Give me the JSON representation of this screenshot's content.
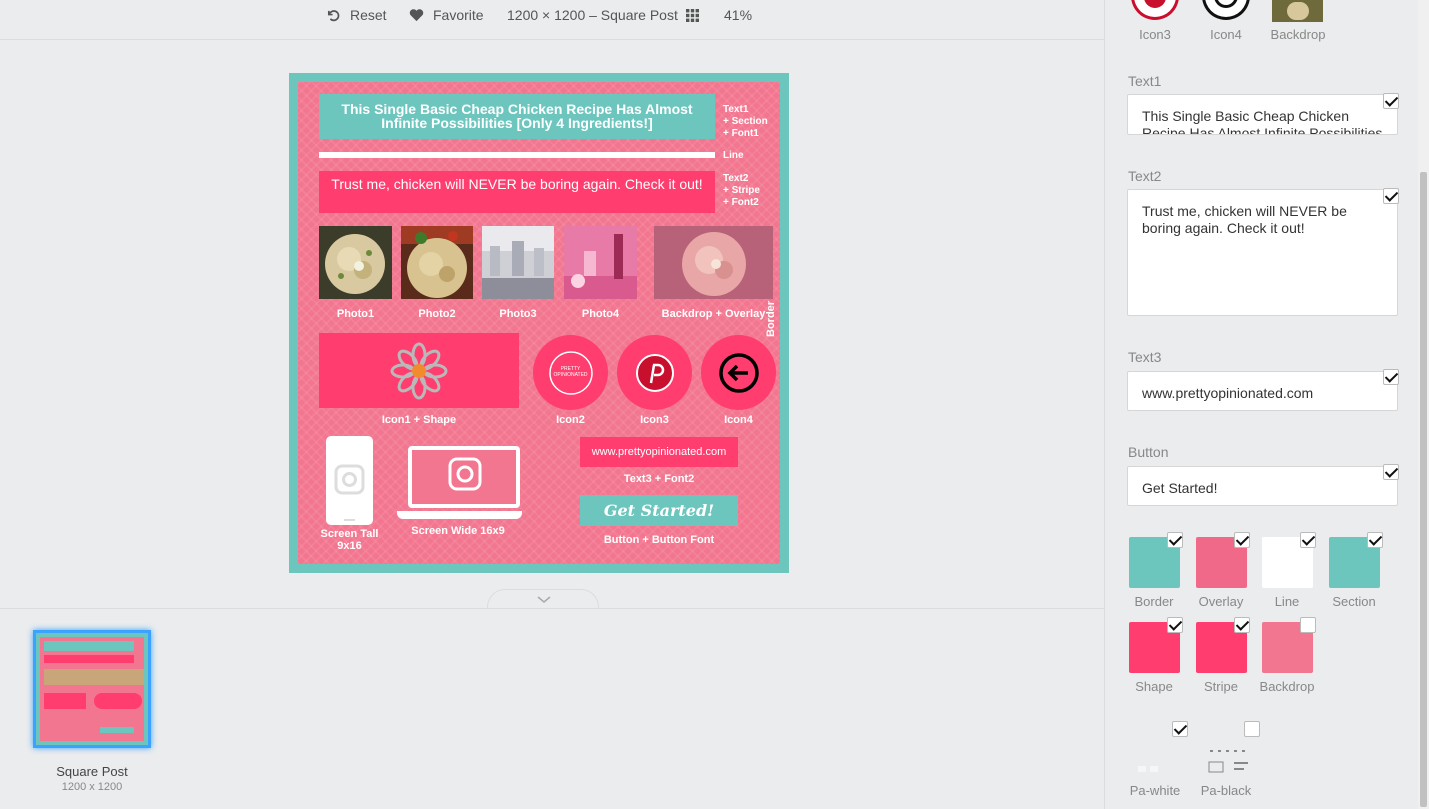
{
  "toolbar": {
    "reset": "Reset",
    "favorite": "Favorite",
    "size": "1200 × 1200 – Square Post",
    "zoom": "41%"
  },
  "canvas": {
    "title": "This Single Basic Cheap Chicken Recipe Has Almost Infinite Possibilities [Only 4 Ingredients!]",
    "stripe_text": "Trust me, chicken will NEVER be boring again. Check it out!",
    "label_text1": [
      "Text1",
      "+ Section",
      "+ Font1"
    ],
    "label_line": "Line",
    "label_text2": [
      "Text2",
      "+ Stripe",
      "+ Font2"
    ],
    "label_border": "Border",
    "photos": [
      "Photo1",
      "Photo2",
      "Photo3",
      "Photo4",
      "Backdrop + Overlay"
    ],
    "icon1_label": "Icon1 + Shape",
    "icon2_label": "Icon2",
    "icon2_text": "PRETTY OPINIONATED",
    "icon3_label": "Icon3",
    "icon4_label": "Icon4",
    "screen_tall": "Screen Tall 9x16",
    "screen_wide": "Screen Wide 16x9",
    "website": "www.prettyopinionated.com",
    "text3_label": "Text3 + Font2",
    "button": "Get Started!",
    "button_label": "Button + Button Font"
  },
  "strip": {
    "name": "Square Post",
    "size": "1200 x 1200"
  },
  "panel": {
    "top_labels": [
      "Icon3",
      "Icon4",
      "Backdrop"
    ],
    "text1_label": "Text1",
    "text1_value": "This Single Basic Cheap Chicken Recipe Has Almost Infinite Possibilities [Only 4 Ingredients!]",
    "text2_label": "Text2",
    "text2_value": "Trust me, chicken will NEVER be boring again. Check it out!",
    "text3_label": "Text3",
    "text3_value": "www.prettyopinionated.com",
    "button_label": "Button",
    "button_value": "Get Started!",
    "swatches": [
      {
        "label": "Border",
        "color": "#6cc6be",
        "checked": true
      },
      {
        "label": "Overlay",
        "color": "#f06989",
        "checked": true
      },
      {
        "label": "Line",
        "color": "#ffffff",
        "checked": true
      },
      {
        "label": "Section",
        "color": "#6cc6be",
        "checked": true
      },
      {
        "label": "Shape",
        "color": "#ff3d6f",
        "checked": true
      },
      {
        "label": "Stripe",
        "color": "#ff3d6f",
        "checked": true
      },
      {
        "label": "Backdrop",
        "color": "#f2768f",
        "checked": false
      }
    ],
    "pa_white": "Pa-white",
    "pa_black": "Pa-black"
  },
  "colors": {
    "teal": "#6cc6be",
    "pink": "#f2768f",
    "hot_pink": "#ff3d6f",
    "selection": "#3aa3ff"
  }
}
